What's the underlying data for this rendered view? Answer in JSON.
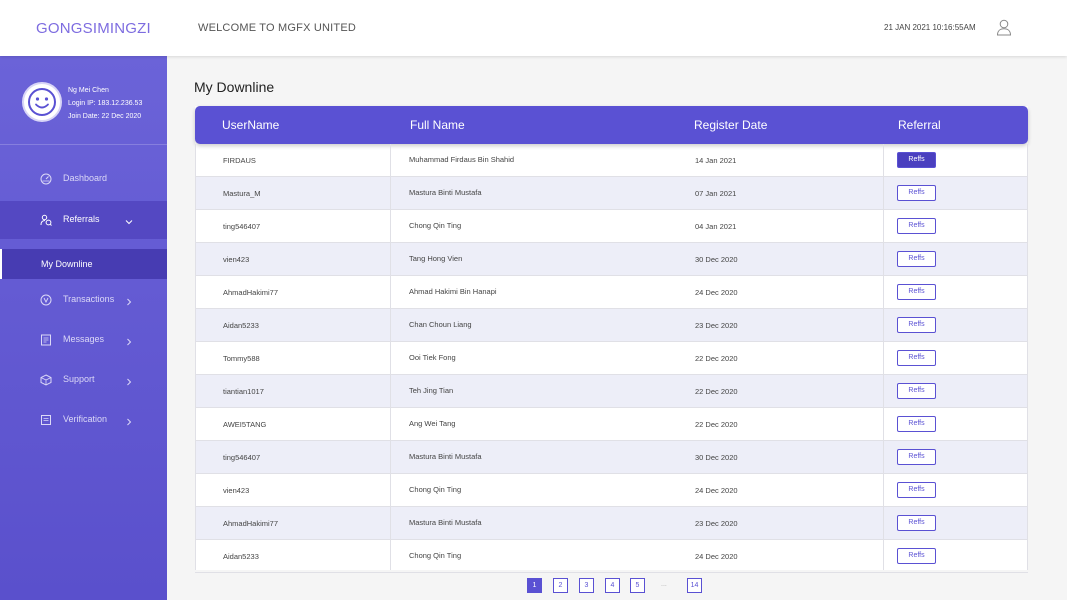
{
  "header": {
    "brand": "GONGSIMINGZI",
    "welcome": "WELCOME TO MGFX UNITED",
    "datetime": "21 JAN 2021 10:16:55AM"
  },
  "profile": {
    "name": "Ng Mei Chen",
    "login_ip": "Login IP: 183.12.236.53",
    "join_date": "Join Date: 22 Dec 2020"
  },
  "sidebar": {
    "items": [
      {
        "label": "Dashboard",
        "icon": "dashboard-icon"
      },
      {
        "label": "Referrals",
        "icon": "referrals-icon"
      },
      {
        "label": "Transactions",
        "icon": "transactions-icon"
      },
      {
        "label": "Messages",
        "icon": "messages-icon"
      },
      {
        "label": "Support",
        "icon": "support-icon"
      },
      {
        "label": "Verification",
        "icon": "verification-icon"
      }
    ],
    "subitem": "My Downline"
  },
  "page_title": "My Downline",
  "table": {
    "headers": [
      "UserName",
      "Full Name",
      "Register Date",
      "Referral"
    ],
    "button_label": "Reffs",
    "rows": [
      {
        "username": "FIRDAUS",
        "fullname": "Muhammad Firdaus Bin Shahid",
        "date": "14 Jan 2021"
      },
      {
        "username": "Mastura_M",
        "fullname": "Mastura Binti Mustafa",
        "date": "07 Jan 2021"
      },
      {
        "username": "ting546407",
        "fullname": "Chong Qin Ting",
        "date": "04 Jan 2021"
      },
      {
        "username": "vien423",
        "fullname": "Tang Hong Vien",
        "date": "30 Dec 2020"
      },
      {
        "username": "AhmadHakimi77",
        "fullname": "Ahmad Hakimi Bin Hanapi",
        "date": "24 Dec 2020"
      },
      {
        "username": "Aidan5233",
        "fullname": "Chan Choun Liang",
        "date": "23 Dec 2020"
      },
      {
        "username": "Tommy588",
        "fullname": "Ooi Tiek Fong",
        "date": "22 Dec 2020"
      },
      {
        "username": "tiantian1017",
        "fullname": "Teh Jing Tian",
        "date": "22 Dec 2020"
      },
      {
        "username": "AWEI5TANG",
        "fullname": "Ang Wei Tang",
        "date": "22 Dec 2020"
      },
      {
        "username": "ting546407",
        "fullname": "Mastura Binti Mustafa",
        "date": "30 Dec 2020"
      },
      {
        "username": "vien423",
        "fullname": "Chong Qin Ting",
        "date": "24 Dec 2020"
      },
      {
        "username": "AhmadHakimi77",
        "fullname": "Mastura Binti Mustafa",
        "date": "23 Dec 2020"
      },
      {
        "username": "Aidan5233",
        "fullname": "Chong Qin Ting",
        "date": "24 Dec 2020"
      }
    ]
  },
  "pagination": {
    "pages": [
      "1",
      "2",
      "3",
      "4",
      "5"
    ],
    "ellipsis": "...",
    "last": "14"
  },
  "colors": {
    "accent": "#5a51d3",
    "sidebar": "#6b63d8",
    "brand": "#7d6ce0"
  }
}
